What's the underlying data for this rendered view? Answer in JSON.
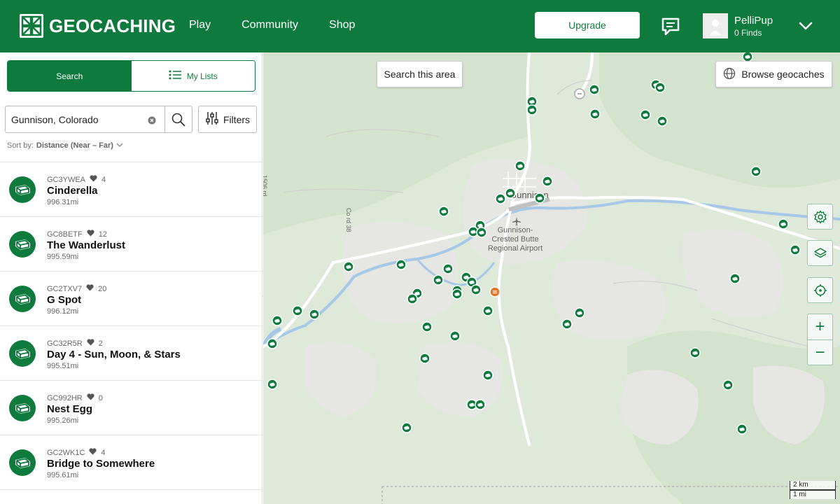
{
  "header": {
    "logo_text": "GEOCACHING",
    "nav": [
      "Play",
      "Community",
      "Shop"
    ],
    "upgrade_label": "Upgrade",
    "user": {
      "name": "PelliPup",
      "finds": "0 Finds"
    },
    "brand_color": "#0f7a3d"
  },
  "sidebar": {
    "tabs": {
      "search": "Search",
      "my_lists": "My Lists"
    },
    "search": {
      "value": "Gunnison, Colorado"
    },
    "filters_label": "Filters",
    "sort": {
      "prefix": "Sort by:",
      "value": "Distance (Near – Far)"
    },
    "caches": [
      {
        "code": "GC3YWEA",
        "favorites": "4",
        "name": "Cinderella",
        "distance": "996.31mi"
      },
      {
        "code": "GC8BETF",
        "favorites": "12",
        "name": "The Wanderlust",
        "distance": "995.59mi"
      },
      {
        "code": "GC2TXV7",
        "favorites": "20",
        "name": "G Spot",
        "distance": "996.12mi"
      },
      {
        "code": "GC32R5R",
        "favorites": "2",
        "name": "Day 4 - Sun, Moon, & Stars",
        "distance": "995.51mi"
      },
      {
        "code": "GC992HR",
        "favorites": "0",
        "name": "Nest Egg",
        "distance": "995.26mi"
      },
      {
        "code": "GC2WK1C",
        "favorites": "4",
        "name": "Bridge to Somewhere",
        "distance": "995.61mi"
      }
    ]
  },
  "map": {
    "search_area_label": "Search this area",
    "browse_label": "Browse geocaches",
    "city_label": "Gunnison",
    "airport_label": [
      "Gunnison-",
      "Crested Butte",
      "Regional Airport"
    ],
    "road_labels": [
      "1506 rd",
      "Co rd 38"
    ],
    "scale": {
      "km": "2 km",
      "mi": "1 mi"
    },
    "controls": {
      "zoom_in": "+",
      "zoom_out": "−"
    }
  }
}
